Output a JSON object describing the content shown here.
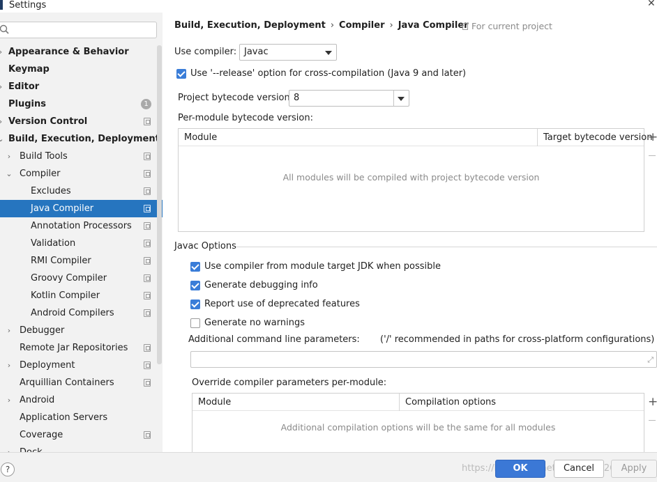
{
  "window": {
    "title": "Settings"
  },
  "sidebar": {
    "search_placeholder": "",
    "items": [
      {
        "label": "Appearance & Behavior",
        "bold": true,
        "indent": 0,
        "chevron": "›"
      },
      {
        "label": "Keymap",
        "bold": true,
        "indent": 0,
        "chevron": ""
      },
      {
        "label": "Editor",
        "bold": true,
        "indent": 0,
        "chevron": "›"
      },
      {
        "label": "Plugins",
        "bold": true,
        "indent": 0,
        "chevron": "",
        "badge": "1"
      },
      {
        "label": "Version Control",
        "bold": true,
        "indent": 0,
        "chevron": "›",
        "project": true
      },
      {
        "label": "Build, Execution, Deployment",
        "bold": true,
        "indent": 0,
        "chevron": "⌄"
      },
      {
        "label": "Build Tools",
        "bold": false,
        "indent": 1,
        "chevron": "›",
        "project": true
      },
      {
        "label": "Compiler",
        "bold": false,
        "indent": 1,
        "chevron": "⌄",
        "project": true
      },
      {
        "label": "Excludes",
        "bold": false,
        "indent": 2,
        "chevron": "",
        "project": true
      },
      {
        "label": "Java Compiler",
        "bold": false,
        "indent": 2,
        "chevron": "",
        "project": true,
        "selected": true
      },
      {
        "label": "Annotation Processors",
        "bold": false,
        "indent": 2,
        "chevron": "",
        "project": true
      },
      {
        "label": "Validation",
        "bold": false,
        "indent": 2,
        "chevron": "",
        "project": true
      },
      {
        "label": "RMI Compiler",
        "bold": false,
        "indent": 2,
        "chevron": "",
        "project": true
      },
      {
        "label": "Groovy Compiler",
        "bold": false,
        "indent": 2,
        "chevron": "",
        "project": true
      },
      {
        "label": "Kotlin Compiler",
        "bold": false,
        "indent": 2,
        "chevron": "",
        "project": true
      },
      {
        "label": "Android Compilers",
        "bold": false,
        "indent": 2,
        "chevron": "",
        "project": true
      },
      {
        "label": "Debugger",
        "bold": false,
        "indent": 1,
        "chevron": "›"
      },
      {
        "label": "Remote Jar Repositories",
        "bold": false,
        "indent": 1,
        "chevron": "",
        "project": true
      },
      {
        "label": "Deployment",
        "bold": false,
        "indent": 1,
        "chevron": "›",
        "project": true
      },
      {
        "label": "Arquillian Containers",
        "bold": false,
        "indent": 1,
        "chevron": "",
        "project": true
      },
      {
        "label": "Android",
        "bold": false,
        "indent": 1,
        "chevron": "›"
      },
      {
        "label": "Application Servers",
        "bold": false,
        "indent": 1,
        "chevron": ""
      },
      {
        "label": "Coverage",
        "bold": false,
        "indent": 1,
        "chevron": "",
        "project": true
      },
      {
        "label": "Dock",
        "bold": false,
        "indent": 1,
        "chevron": "›"
      }
    ]
  },
  "breadcrumb": {
    "parts": [
      "Build, Execution, Deployment",
      "Compiler",
      "Java Compiler"
    ],
    "separator": "›",
    "scope": "For current project"
  },
  "compiler": {
    "use_compiler_label": "Use compiler:",
    "use_compiler_value": "Javac",
    "release_option_label": "Use '--release' option for cross-compilation (Java 9 and later)",
    "release_option_checked": true,
    "bytecode_label": "Project bytecode version:",
    "bytecode_value": "8",
    "per_module_label": "Per-module bytecode version:",
    "per_module_table": {
      "columns": [
        "Module",
        "Target bytecode version"
      ],
      "empty_text": "All modules will be compiled with project bytecode version",
      "add_icon": "+",
      "remove_icon": "−"
    }
  },
  "javac": {
    "group_title": "Javac Options",
    "options": [
      {
        "label": "Use compiler from module target JDK when possible",
        "checked": true
      },
      {
        "label": "Generate debugging info",
        "checked": true
      },
      {
        "label": "Report use of deprecated features",
        "checked": true
      },
      {
        "label": "Generate no warnings",
        "checked": false
      }
    ],
    "additional_params_label": "Additional command line parameters:",
    "additional_params_hint": "('/' recommended in paths for cross-platform configurations)",
    "additional_params_value": "",
    "override_label": "Override compiler parameters per-module:",
    "override_table": {
      "columns": [
        "Module",
        "Compilation options"
      ],
      "empty_text": "Additional compilation options will be the same for all modules",
      "add_icon": "+",
      "remove_icon": "−"
    }
  },
  "footer": {
    "help_label": "?",
    "ok_label": "OK",
    "cancel_label": "Cancel",
    "apply_label": "Apply",
    "watermark": "https://blog.csdn.net/weixin_45264883"
  },
  "colors": {
    "selection": "#2675bf",
    "checkbox": "#3a7dd8",
    "ok_button": "#3b78d6"
  }
}
